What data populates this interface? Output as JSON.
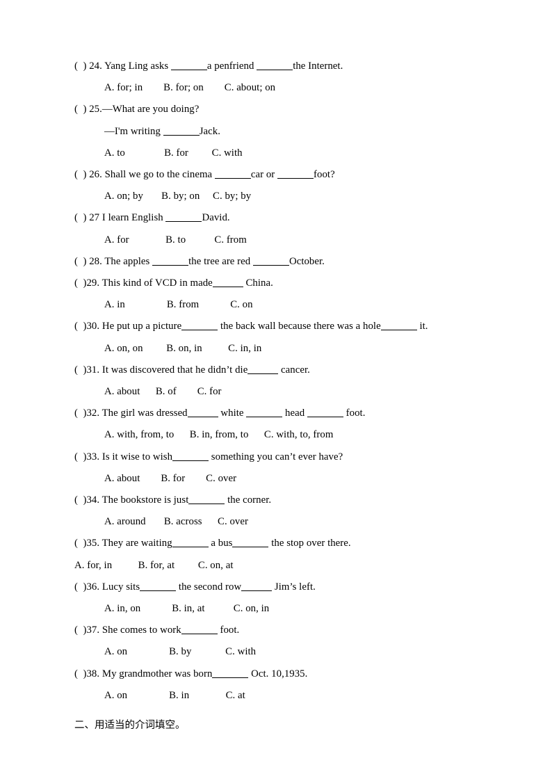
{
  "document": {
    "questions": [
      {
        "marker": "(  ) 24. ",
        "parts": [
          "Yang Ling asks ",
          "a penfriend ",
          "the Internet."
        ],
        "blank_sizes": [
          "b-lg",
          "b-lg"
        ],
        "options": "A. for; in        B. for; on        C. about; on",
        "options_flush": false
      },
      {
        "marker": "(  ) 25.",
        "parts": [
          "—What are you doing?"
        ],
        "blank_sizes": [],
        "options": null,
        "options_flush": false
      },
      {
        "marker": "",
        "parts": [
          "—I'm writing ",
          "Jack."
        ],
        "blank_sizes": [
          "b-lg"
        ],
        "options": "A. to               B. for         C. with",
        "options_flush": false,
        "continuation": true
      },
      {
        "marker": "(  ) 26. ",
        "parts": [
          "Shall we go to the cinema ",
          "car or ",
          "foot?"
        ],
        "blank_sizes": [
          "b-lg",
          "b-lg"
        ],
        "options": "A. on; by       B. by; on     C. by; by",
        "options_flush": false
      },
      {
        "marker": "(  ) 27 ",
        "parts": [
          "I learn English ",
          "David."
        ],
        "blank_sizes": [
          "b-lg"
        ],
        "options": "A. for              B. to           C. from",
        "options_flush": false
      },
      {
        "marker": "(  ) 28. ",
        "parts": [
          "The apples ",
          "the tree are red ",
          "October."
        ],
        "blank_sizes": [
          "b-lg",
          "b-lg"
        ],
        "options": null,
        "options_flush": false
      },
      {
        "marker": "(  )29. ",
        "parts": [
          "This kind of VCD in made",
          " China."
        ],
        "blank_sizes": [
          "b-md"
        ],
        "options": "A. in                B. from            C. on",
        "options_flush": false
      },
      {
        "marker": "(  )30. ",
        "parts": [
          "He put up a picture",
          " the back wall because there was a hole",
          " it."
        ],
        "blank_sizes": [
          "b-lg",
          "b-lg"
        ],
        "options": "A. on, on         B. on, in          C. in, in",
        "options_flush": false
      },
      {
        "marker": "(  )31. ",
        "parts": [
          "It was discovered that he didn’t die",
          " cancer."
        ],
        "blank_sizes": [
          "b-md"
        ],
        "options": "A. about      B. of        C. for",
        "options_flush": false
      },
      {
        "marker": "(  )32. ",
        "parts": [
          "The girl was dressed",
          " white ",
          " head ",
          " foot."
        ],
        "blank_sizes": [
          "b-md",
          "b-lg",
          "b-lg"
        ],
        "options": "A. with, from, to      B. in, from, to      C. with, to, from",
        "options_flush": false
      },
      {
        "marker": "(  )33. ",
        "parts": [
          "Is it wise to wish",
          " something you can’t ever have?"
        ],
        "blank_sizes": [
          "b-lg"
        ],
        "options": "A. about        B. for        C. over",
        "options_flush": false
      },
      {
        "marker": "(  )34. ",
        "parts": [
          "The bookstore is just",
          " the corner."
        ],
        "blank_sizes": [
          "b-lg"
        ],
        "options": "A. around       B. across      C. over",
        "options_flush": false
      },
      {
        "marker": "(  )35. ",
        "parts": [
          "They are waiting",
          " a bus",
          " the stop over there."
        ],
        "blank_sizes": [
          "b-lg",
          "b-lg"
        ],
        "options": "A. for, in          B. for, at         C. on, at",
        "options_flush": true
      },
      {
        "marker": "(  )36. ",
        "parts": [
          "Lucy sits",
          " the second row",
          " Jim’s left."
        ],
        "blank_sizes": [
          "b-lg",
          "b-md"
        ],
        "options": "A. in, on            B. in, at           C. on, in",
        "options_flush": false
      },
      {
        "marker": "(  )37. ",
        "parts": [
          "She comes to work",
          " foot."
        ],
        "blank_sizes": [
          "b-lg"
        ],
        "options": "A. on                B. by             C. with",
        "options_flush": false
      },
      {
        "marker": "(  )38. ",
        "parts": [
          "My grandmother was born",
          " Oct. 10,1935."
        ],
        "blank_sizes": [
          "b-lg"
        ],
        "options": "A. on                B. in              C. at",
        "options_flush": false
      }
    ],
    "section_heading": "二、用适当的介词填空。"
  }
}
